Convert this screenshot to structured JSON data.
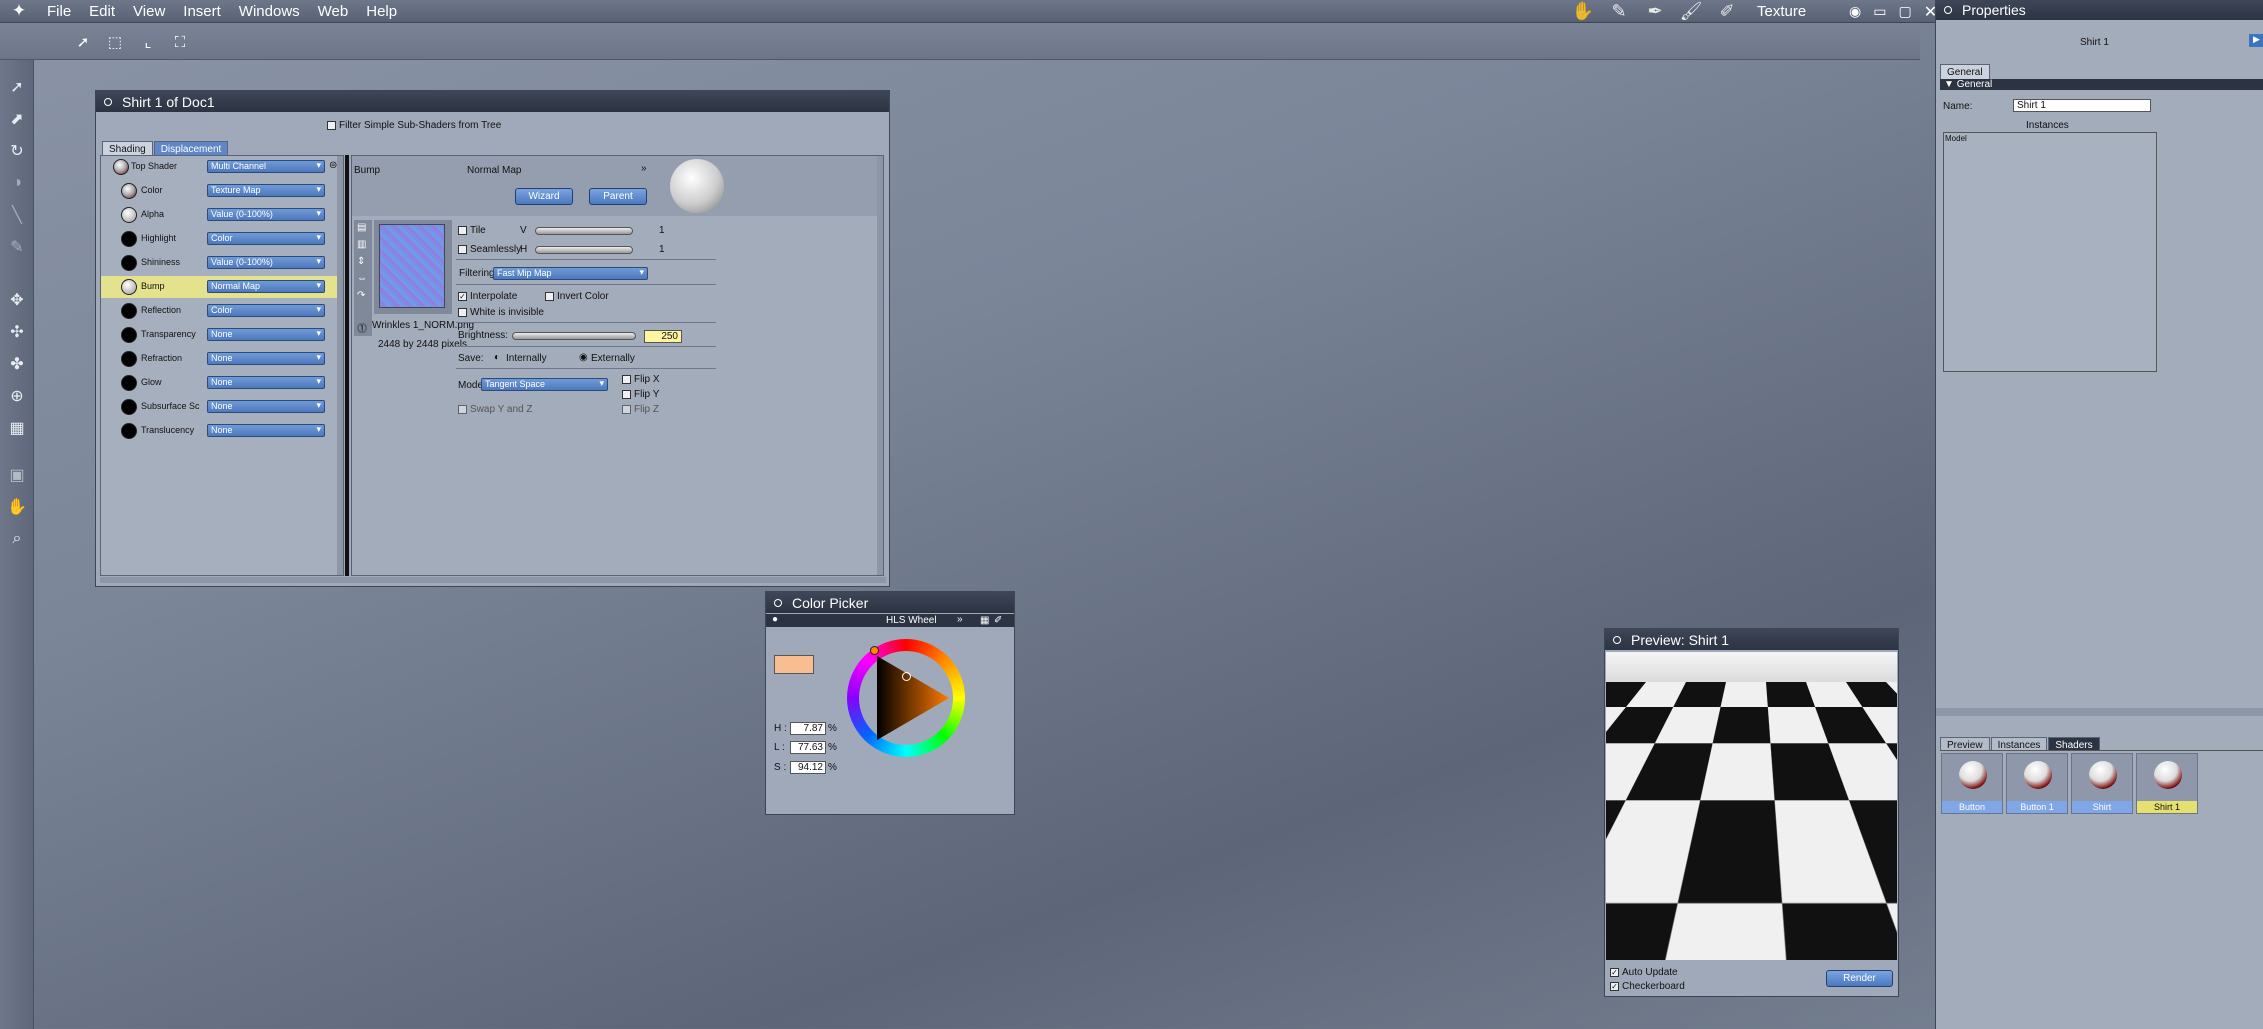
{
  "menu": {
    "items": [
      "File",
      "Edit",
      "View",
      "Insert",
      "Windows",
      "Web",
      "Help"
    ],
    "room": "Texture"
  },
  "shader_window": {
    "title": "Shirt 1 of Doc1",
    "filter_label": "Filter Simple Sub-Shaders from Tree",
    "tabs": [
      "Shading",
      "Displacement"
    ],
    "channels": [
      {
        "label": "Top Shader",
        "value": "Multi Channel"
      },
      {
        "label": "Color",
        "value": "Texture Map"
      },
      {
        "label": "Alpha",
        "value": "Value (0-100%)"
      },
      {
        "label": "Highlight",
        "value": "Color"
      },
      {
        "label": "Shininess",
        "value": "Value (0-100%)"
      },
      {
        "label": "Bump",
        "value": "Normal Map"
      },
      {
        "label": "Reflection",
        "value": "Color"
      },
      {
        "label": "Transparency",
        "value": "None"
      },
      {
        "label": "Refraction",
        "value": "None"
      },
      {
        "label": "Glow",
        "value": "None"
      },
      {
        "label": "Subsurface Sc",
        "value": "None"
      },
      {
        "label": "Translucency",
        "value": "None"
      }
    ],
    "detail": {
      "channel": "Bump",
      "type": "Normal Map",
      "wizard": "Wizard",
      "parent": "Parent",
      "filename": "Wrinkles 1_NORM.png",
      "size": "2448 by 2448 pixels",
      "tile": "Tile",
      "seamlessly": "Seamlessly",
      "v_label": "V",
      "h_label": "H",
      "v_value": "1",
      "h_value": "1",
      "filtering_label": "Filtering:",
      "filtering_value": "Fast Mip Map",
      "interpolate": "Interpolate",
      "invert_color": "Invert Color",
      "white_invisible": "White is invisible",
      "brightness_label": "Brightness:",
      "brightness_value": "250",
      "save_label": "Save:",
      "internally": "Internally",
      "externally": "Externally",
      "mode_label": "Mode",
      "mode_value": "Tangent Space",
      "flip_x": "Flip X",
      "flip_y": "Flip Y",
      "flip_z": "Flip Z",
      "swap": "Swap Y and Z"
    }
  },
  "color_picker": {
    "title": "Color Picker",
    "mode": "HLS Wheel",
    "h_label": "H :",
    "l_label": "L :",
    "s_label": "S :",
    "h": "7.87",
    "l": "77.63",
    "s": "94.12",
    "pct": "%",
    "swatch": "#f9bd92"
  },
  "preview": {
    "title": "Preview: Shirt 1",
    "auto_update": "Auto Update",
    "checkerboard": "Checkerboard",
    "render": "Render"
  },
  "properties": {
    "title": "Properties",
    "object": "Shirt 1",
    "tab": "General",
    "section": "General",
    "name_label": "Name:",
    "name_value": "Shirt 1",
    "instances_label": "Instances",
    "list_header": "Model",
    "bottom_tabs": [
      "Preview",
      "Instances",
      "Shaders"
    ],
    "shaders": [
      "Button",
      "Button 1",
      "Shirt",
      "Shirt 1"
    ]
  }
}
